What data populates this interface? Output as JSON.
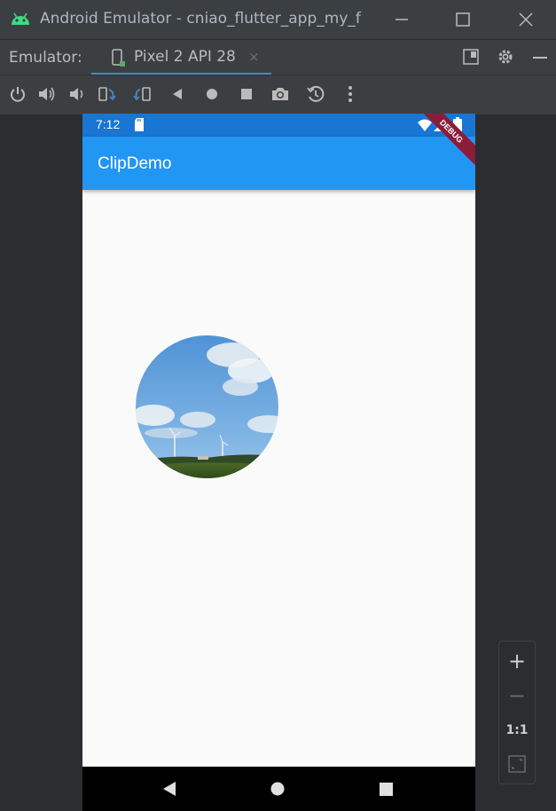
{
  "window": {
    "title": "Android Emulator - cniao_flutter_app_my_f",
    "minimize_icon": "minimize-icon",
    "maximize_icon": "maximize-icon",
    "close_icon": "close-icon"
  },
  "tabbar": {
    "label": "Emulator:",
    "tab_label": "Pixel 2 API 28",
    "tab_close": "×"
  },
  "toolbar": {
    "icons": [
      "power-icon",
      "volume-up-icon",
      "volume-down-icon",
      "rotate-left-icon",
      "rotate-right-icon",
      "back-icon",
      "home-icon",
      "overview-icon",
      "screenshot-icon",
      "snapshot-icon",
      "more-icon"
    ]
  },
  "device": {
    "status_time": "7:12",
    "app_title": "ClipDemo",
    "debug_banner": "DEBUG"
  },
  "zoom": {
    "plus": "+",
    "minus": "−",
    "one_to_one": "1:1"
  },
  "colors": {
    "app_bar": "#2196f3",
    "status_bar": "#1976d2",
    "accent_tab": "#4a88c7"
  }
}
